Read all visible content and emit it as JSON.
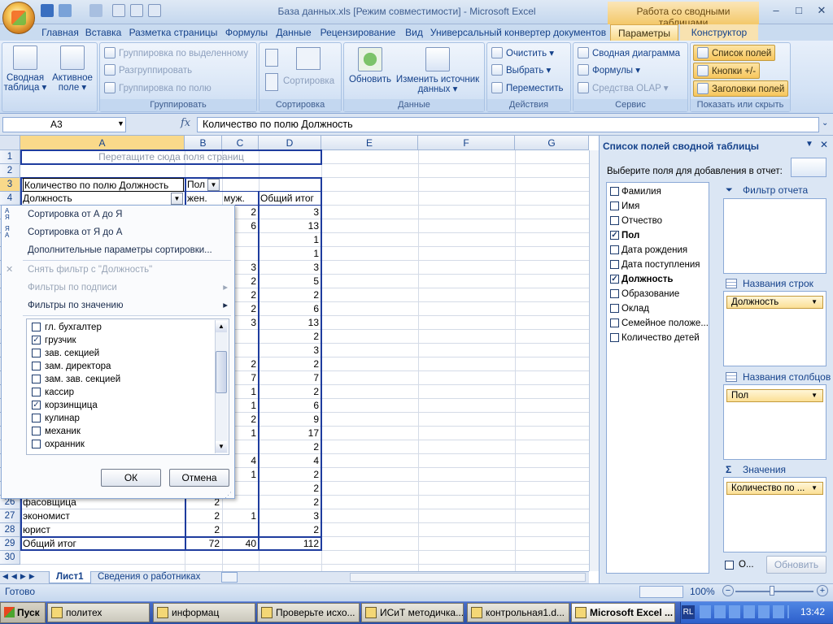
{
  "window": {
    "title": "База данных.xls  [Режим совместимости] - Microsoft Excel",
    "context_title": "Работа со сводными таблицами",
    "min": "–",
    "max": "□",
    "close": "✕"
  },
  "tabs": [
    "Главная",
    "Вставка",
    "Разметка страницы",
    "Формулы",
    "Данные",
    "Рецензирование",
    "Вид",
    "Универсальный конвертер документов",
    "Параметры",
    "Конструктор"
  ],
  "ribbon": {
    "pivot": {
      "label": "Сводная таблица ▾",
      "active_field": "Активное поле ▾"
    },
    "group": {
      "items": [
        "Группировка по выделенному",
        "Разгруппировать",
        "Группировка по полю"
      ],
      "label": "Группировать"
    },
    "sort": {
      "sort_label": "Сортировка",
      "label": "Сортировка"
    },
    "data": {
      "refresh": "Обновить",
      "change_source": "Изменить источник данных ▾",
      "label": "Данные"
    },
    "actions": {
      "items": [
        "Очистить ▾",
        "Выбрать ▾",
        "Переместить"
      ],
      "label": "Действия"
    },
    "service": {
      "items": [
        "Сводная диаграмма",
        "Формулы ▾",
        "Средства OLAP ▾"
      ],
      "label": "Сервис"
    },
    "show": {
      "items": [
        "Список полей",
        "Кнопки +/-",
        "Заголовки полей"
      ],
      "label": "Показать или скрыть"
    }
  },
  "formula": {
    "namebox": "A3",
    "fx": "fx",
    "value": "Количество по полю Должность"
  },
  "grid": {
    "cols": [
      "A",
      "B",
      "C",
      "D",
      "E",
      "F",
      "G"
    ],
    "rows": [
      "1",
      "2",
      "3",
      "4",
      "5",
      "6",
      "7",
      "8",
      "9",
      "10",
      "11",
      "12",
      "13",
      "14",
      "15",
      "16",
      "17",
      "18",
      "19",
      "20",
      "21",
      "22",
      "23",
      "24",
      "25",
      "26",
      "27",
      "28",
      "29",
      "30"
    ],
    "page_drop": "Перетащите сюда поля страниц",
    "a3": "Количество по полю Должность",
    "b3": "Пол",
    "a4": "Должность",
    "b4": "жен.",
    "c4": "муж.",
    "d4": "Общий итог",
    "colB": [
      "",
      "",
      "",
      "",
      "",
      "",
      "",
      "",
      "",
      "",
      "",
      "",
      "",
      "",
      "",
      "",
      "",
      "",
      "",
      "",
      "",
      "2",
      "2",
      "2"
    ],
    "colC": [
      "2",
      "6",
      "",
      "",
      "3",
      "2",
      "2",
      "2",
      "3",
      "",
      "",
      "2",
      "7",
      "1",
      "1",
      "2",
      "1",
      "",
      "4",
      "1",
      "",
      "",
      "1",
      ""
    ],
    "colD": [
      "3",
      "13",
      "1",
      "1",
      "3",
      "5",
      "2",
      "6",
      "13",
      "2",
      "3",
      "2",
      "7",
      "2",
      "6",
      "9",
      "17",
      "2",
      "4",
      "2",
      "2",
      "2",
      "3",
      "2"
    ],
    "a26": "фасовщица",
    "a27": "экономист",
    "a28": "юрист",
    "a29": "Общий итог",
    "b29": "72",
    "c29": "40",
    "d29": "112"
  },
  "popup": {
    "sort_az": "Сортировка от А до Я",
    "sort_za": "Сортировка от Я до А",
    "sort_more": "Дополнительные параметры сортировки...",
    "clear_filter": "Снять фильтр с \"Должность\"",
    "label_filters": "Фильтры по подписи",
    "value_filters": "Фильтры по значению",
    "items": [
      {
        "label": "гл. бухгалтер",
        "checked": false
      },
      {
        "label": "грузчик",
        "checked": true
      },
      {
        "label": "зав. секцией",
        "checked": false
      },
      {
        "label": "зам. директора",
        "checked": false
      },
      {
        "label": "зам. зав. секцией",
        "checked": false
      },
      {
        "label": "кассир",
        "checked": false
      },
      {
        "label": "корзинщица",
        "checked": true
      },
      {
        "label": "кулинар",
        "checked": false
      },
      {
        "label": "механик",
        "checked": false
      },
      {
        "label": "охранник",
        "checked": false
      }
    ],
    "ok": "ОК",
    "cancel": "Отмена"
  },
  "sheets": [
    "Лист1",
    "Сведения о работниках"
  ],
  "status": {
    "ready": "Готово",
    "zoom": "100%"
  },
  "pane": {
    "title": "Список полей сводной таблицы",
    "choose": "Выберите поля для добавления в отчет:",
    "fields": [
      {
        "label": "Фамилия",
        "checked": false
      },
      {
        "label": "Имя",
        "checked": false
      },
      {
        "label": "Отчество",
        "checked": false
      },
      {
        "label": "Пол",
        "checked": true
      },
      {
        "label": "Дата рождения",
        "checked": false
      },
      {
        "label": "Дата поступления",
        "checked": false
      },
      {
        "label": "Должность",
        "checked": true
      },
      {
        "label": "Образование",
        "checked": false
      },
      {
        "label": "Оклад",
        "checked": false
      },
      {
        "label": "Семейное положе...",
        "checked": false
      },
      {
        "label": "Количество детей",
        "checked": false
      }
    ],
    "report_filter": "Фильтр отчета",
    "row_labels": "Названия строк",
    "row_pill": "Должность",
    "col_labels": "Названия столбцов",
    "col_pill": "Пол",
    "values": "Значения",
    "values_pill": "Количество по ...",
    "defer": "О...",
    "update": "Обновить"
  },
  "taskbar": {
    "start": "Пуск",
    "tasks": [
      "политех",
      "информац",
      "Проверьте исхо...",
      "ИСиТ методичка...",
      "контрольная1.d...",
      "Microsoft Excel ..."
    ],
    "lang": "RL",
    "clock": "13:42"
  }
}
